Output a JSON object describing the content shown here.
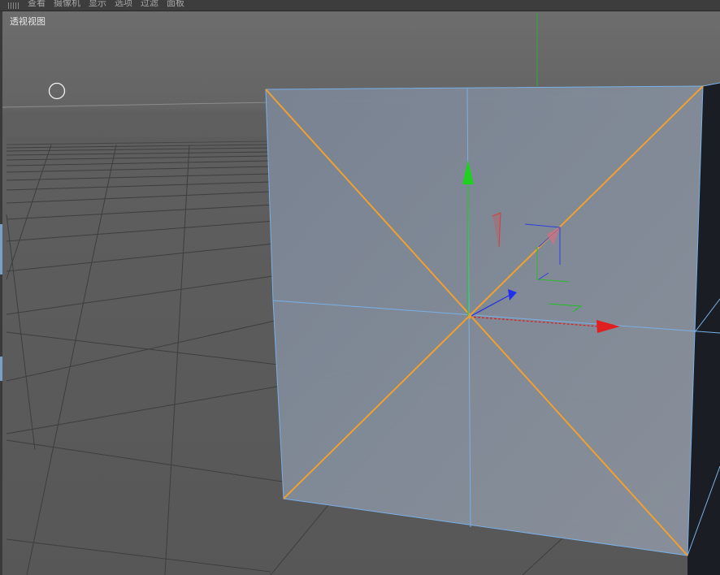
{
  "menubar": {
    "items": [
      {
        "label": "查看"
      },
      {
        "label": "摄像机"
      },
      {
        "label": "显示"
      },
      {
        "label": "选项"
      },
      {
        "label": "过滤"
      },
      {
        "label": "面板"
      }
    ]
  },
  "viewport": {
    "view_label": "透视视图"
  },
  "icons": {
    "menu_grip": "grip-icon",
    "cursor": "circle-cursor-icon",
    "axis_gizmo": "move-gizmo-icon"
  },
  "colors": {
    "selection_edge": "#f0a030",
    "cube_face": "#7d8896",
    "wire": "#7ab4e8",
    "axis_x": "#e02020",
    "axis_y": "#20d020",
    "axis_z": "#2030e0"
  }
}
